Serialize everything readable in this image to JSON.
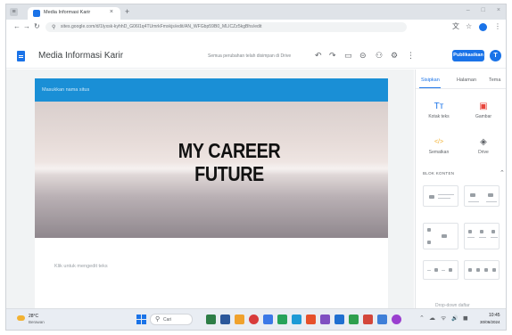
{
  "browser": {
    "tab_title": "Media Informasi Karir",
    "tab_close": "×",
    "new_tab": "+",
    "win_menu": "≡",
    "win_controls": [
      "–",
      "□",
      "×"
    ],
    "url": "sites.google.com/d/1lyxsk-kyhhD_G06l1q4TUmrkFmxkjs/edit/AN_WFGbp59B0_MLICZz5kgBhs/edit"
  },
  "sites_header": {
    "doc_title": "Media Informasi Karir",
    "status": "Semua perubahan telah disimpan di Drive",
    "publish_label": "Publikasikan",
    "avatar_letter": "T"
  },
  "canvas": {
    "nav_band_text": "Masukkan nama situs",
    "hero_lines": [
      "MY CAREER",
      "FUTURE"
    ],
    "body_placeholder": "Klik untuk mengedit teks"
  },
  "right_panel": {
    "tabs": [
      {
        "label": "Sisipkan",
        "active": true
      },
      {
        "label": "Halaman",
        "active": false
      },
      {
        "label": "Tema",
        "active": false
      }
    ],
    "insert_items": [
      {
        "glyph": "Tт",
        "label": "Kotak teks",
        "color": "#1a73e8"
      },
      {
        "glyph": "▣",
        "label": "Gambar",
        "color": "#e8453c"
      },
      {
        "glyph": "</>",
        "label": "Sematkan",
        "color": "#f2b233"
      },
      {
        "glyph": "◈",
        "label": "Drive",
        "color": "#5f6368"
      }
    ],
    "section_label": "BLOK KONTEN",
    "collapse_glyph": "⌃",
    "bottom_text": "Drop-down daftar"
  },
  "taskbar": {
    "temp": "28°C",
    "condition": "Berawan",
    "search_label": "Cari",
    "time": "10:45",
    "date": "30/06/2024",
    "tray_glyphs": [
      "⌃",
      "☁",
      "ᯤ",
      "🔊",
      "◼"
    ]
  },
  "colors": {
    "accent": "#1a73e8",
    "nav_band": "#1a8fd6"
  }
}
